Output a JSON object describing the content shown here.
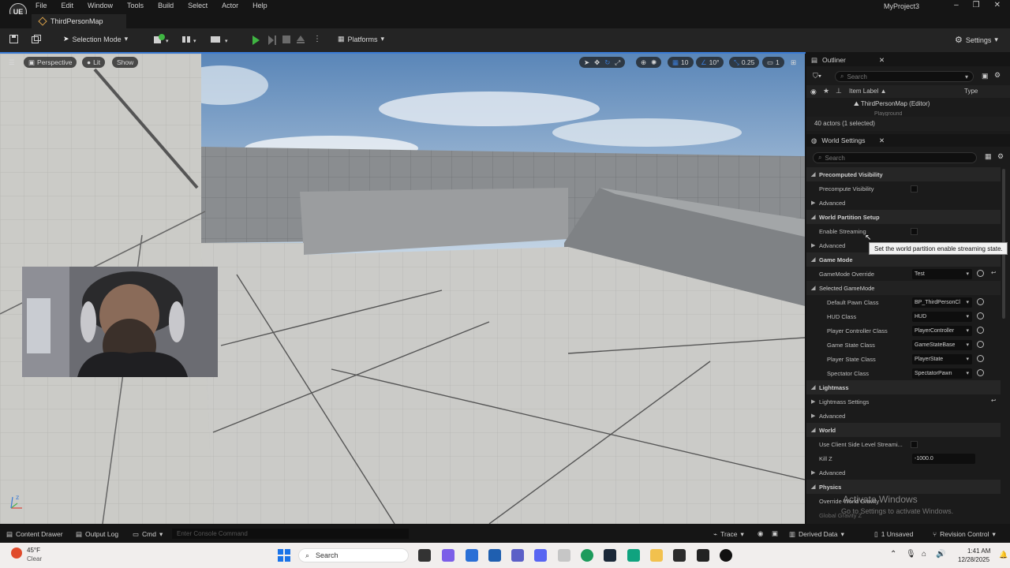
{
  "menubar": {
    "logo": "UE",
    "items": [
      "File",
      "Edit",
      "Window",
      "Tools",
      "Build",
      "Select",
      "Actor",
      "Help"
    ],
    "project_name": "MyProject3",
    "minimize_icon": "–",
    "maximize_icon": "❐",
    "close_icon": "✕"
  },
  "tab": {
    "label": "ThirdPersonMap"
  },
  "toolbar": {
    "selection_mode": "Selection Mode",
    "platforms": "Platforms",
    "settings": "Settings"
  },
  "viewport": {
    "perspective": "Perspective",
    "lit": "Lit",
    "show": "Show",
    "grid_snap": "10",
    "rot_snap": "10°",
    "scale_snap": "0.25",
    "camera_speed": "1",
    "axis_label": "z"
  },
  "webcam": {
    "label": "webcam overlay"
  },
  "outliner": {
    "title": "Outliner",
    "search_placeholder": "Search",
    "col_label": "Item Label ▲",
    "col_type": "Type",
    "row_map": "ThirdPersonMap (Editor)",
    "row_partial": "Playground",
    "actors_count": "40 actors (1 selected)"
  },
  "world_settings": {
    "title": "World Settings",
    "search_placeholder": "Search",
    "rows": {
      "precomputed_visibility": "Precomputed Visibility",
      "precompute_visibility": "Precompute Visibility",
      "advanced1": "Advanced",
      "world_partition_setup": "World Partition Setup",
      "enable_streaming": "Enable Streaming",
      "advanced2": "Advanced",
      "game_mode": "Game Mode",
      "gamemode_override": "GameMode Override",
      "gamemode_override_value": "Test",
      "selected_gamemode": "Selected GameMode",
      "default_pawn": "Default Pawn Class",
      "default_pawn_value": "BP_ThirdPersonCl",
      "hud_class": "HUD Class",
      "hud_class_value": "HUD",
      "player_controller": "Player Controller Class",
      "player_controller_value": "PlayerController",
      "game_state": "Game State Class",
      "game_state_value": "GameStateBase",
      "player_state": "Player State Class",
      "player_state_value": "PlayerState",
      "spectator": "Spectator Class",
      "spectator_value": "SpectatorPawn",
      "lightmass": "Lightmass",
      "lightmass_settings": "Lightmass Settings",
      "advanced3": "Advanced",
      "world": "World",
      "client_streaming": "Use Client Side Level Streami...",
      "kill_z": "Kill Z",
      "kill_z_value": "-1000.0",
      "advanced4": "Advanced",
      "physics": "Physics",
      "override_gravity": "Override World Gravity",
      "global_gravity": "Global Gravity Z"
    }
  },
  "tooltip": "Set the world partition enable streaming state.",
  "watermark": {
    "line1": "Activate Windows",
    "line2": "Go to Settings to activate Windows."
  },
  "bottombar": {
    "content_drawer": "Content Drawer",
    "output_log": "Output Log",
    "cmd": "Cmd",
    "console_placeholder": "Enter Console Command",
    "trace": "Trace",
    "derived_data": "Derived Data",
    "unsaved": "1 Unsaved",
    "revision_control": "Revision Control"
  },
  "taskbar": {
    "weather_temp": "45°F",
    "weather_desc": "Clear",
    "search": "Search",
    "time": "1:41 AM",
    "date": "12/28/2025"
  },
  "colors": {
    "accent": "#3a7bd5",
    "play": "#3fb542"
  }
}
